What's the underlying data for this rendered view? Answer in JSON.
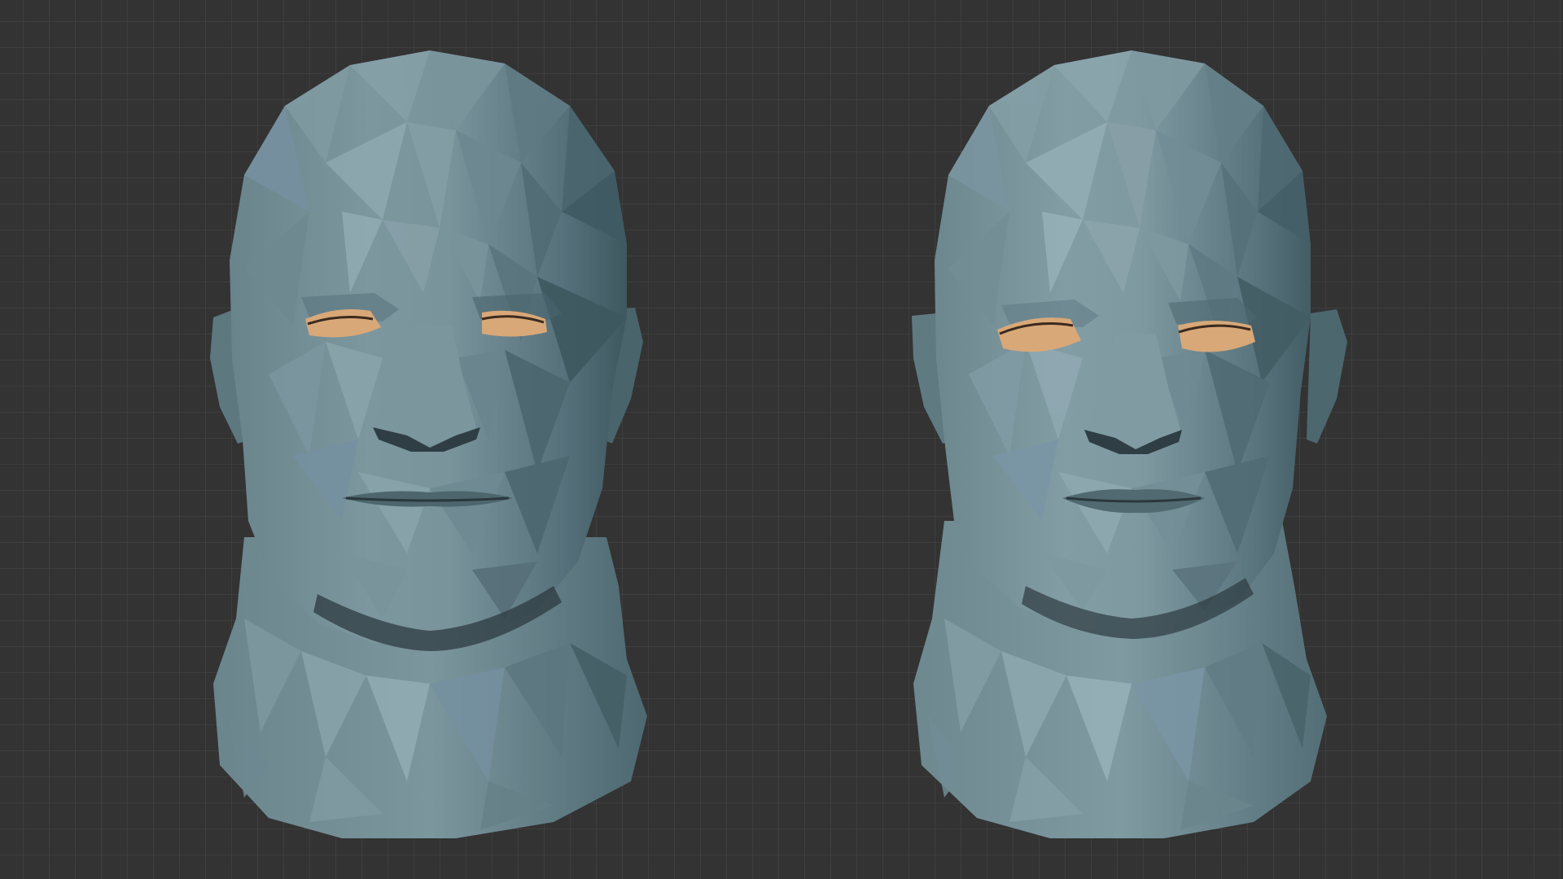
{
  "viewport": {
    "background_color": "#333333",
    "grid_color": "rgba(255,255,255,0.055)"
  },
  "models": [
    {
      "name": "low-poly-head-left",
      "skin_color": "#6f8a92",
      "eye_color": "#d8a878"
    },
    {
      "name": "low-poly-head-right",
      "skin_color": "#74909a",
      "eye_color": "#d8a878"
    }
  ]
}
